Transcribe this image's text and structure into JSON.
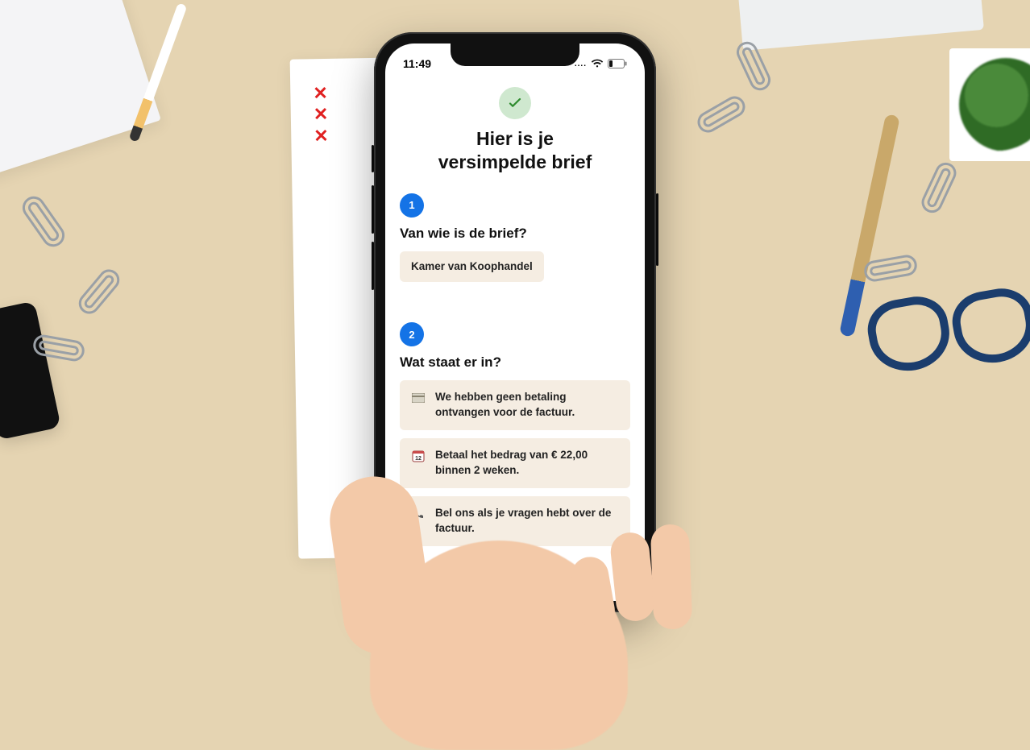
{
  "status": {
    "time": "11:49",
    "signal_dots": "....",
    "wifi_icon": "wifi",
    "battery_icon": "battery-low"
  },
  "header": {
    "title_line1": "Hier is je",
    "title_line2": "versimpelde brief"
  },
  "sections": [
    {
      "step": "1",
      "heading": "Van wie is de brief?",
      "items": [
        {
          "icon": null,
          "text": "Kamer van Koophandel"
        }
      ]
    },
    {
      "step": "2",
      "heading": "Wat staat er in?",
      "items": [
        {
          "icon": "card",
          "text": "We hebben geen betaling ontvangen voor de factuur."
        },
        {
          "icon": "calendar",
          "text": "Betaal het bedrag van € 22,00 binnen 2 weken."
        },
        {
          "icon": "phone",
          "text": "Bel ons als je vragen hebt over de factuur."
        }
      ]
    }
  ]
}
